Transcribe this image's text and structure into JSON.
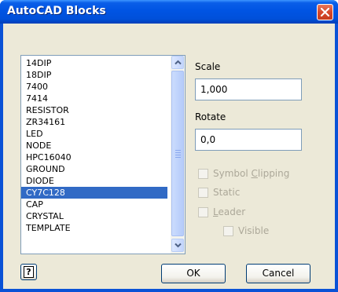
{
  "window": {
    "title": "AutoCAD Blocks",
    "close_icon": "close-icon"
  },
  "blocks_list": {
    "items": [
      "14DIP",
      "18DIP",
      "7400",
      "7414",
      "RESISTOR",
      "ZR34161",
      "LED",
      "NODE",
      "HPC16040",
      "GROUND",
      "DIODE",
      "CY7C128",
      "CAP",
      "CRYSTAL",
      "TEMPLATE"
    ],
    "selected": "CY7C128"
  },
  "scale": {
    "label": "Scale",
    "value": "1,000"
  },
  "rotate": {
    "label": "Rotate",
    "value": "0,0"
  },
  "options": {
    "symbol_clipping": {
      "pre": "Symbol ",
      "key": "C",
      "post": "lipping",
      "checked": false,
      "enabled": false
    },
    "static": {
      "label": "Static",
      "checked": false,
      "enabled": false
    },
    "leader": {
      "pre": "",
      "key": "L",
      "post": "eader",
      "checked": false,
      "enabled": false
    },
    "visible": {
      "label": "Visible",
      "checked": false,
      "enabled": false
    }
  },
  "buttons": {
    "help_glyph": "?",
    "ok": "OK",
    "cancel": "Cancel"
  },
  "colors": {
    "titlebar": "#0054e3",
    "selection": "#316ac5",
    "dialog_bg": "#ece9d8",
    "disabled_text": "#aca899"
  }
}
